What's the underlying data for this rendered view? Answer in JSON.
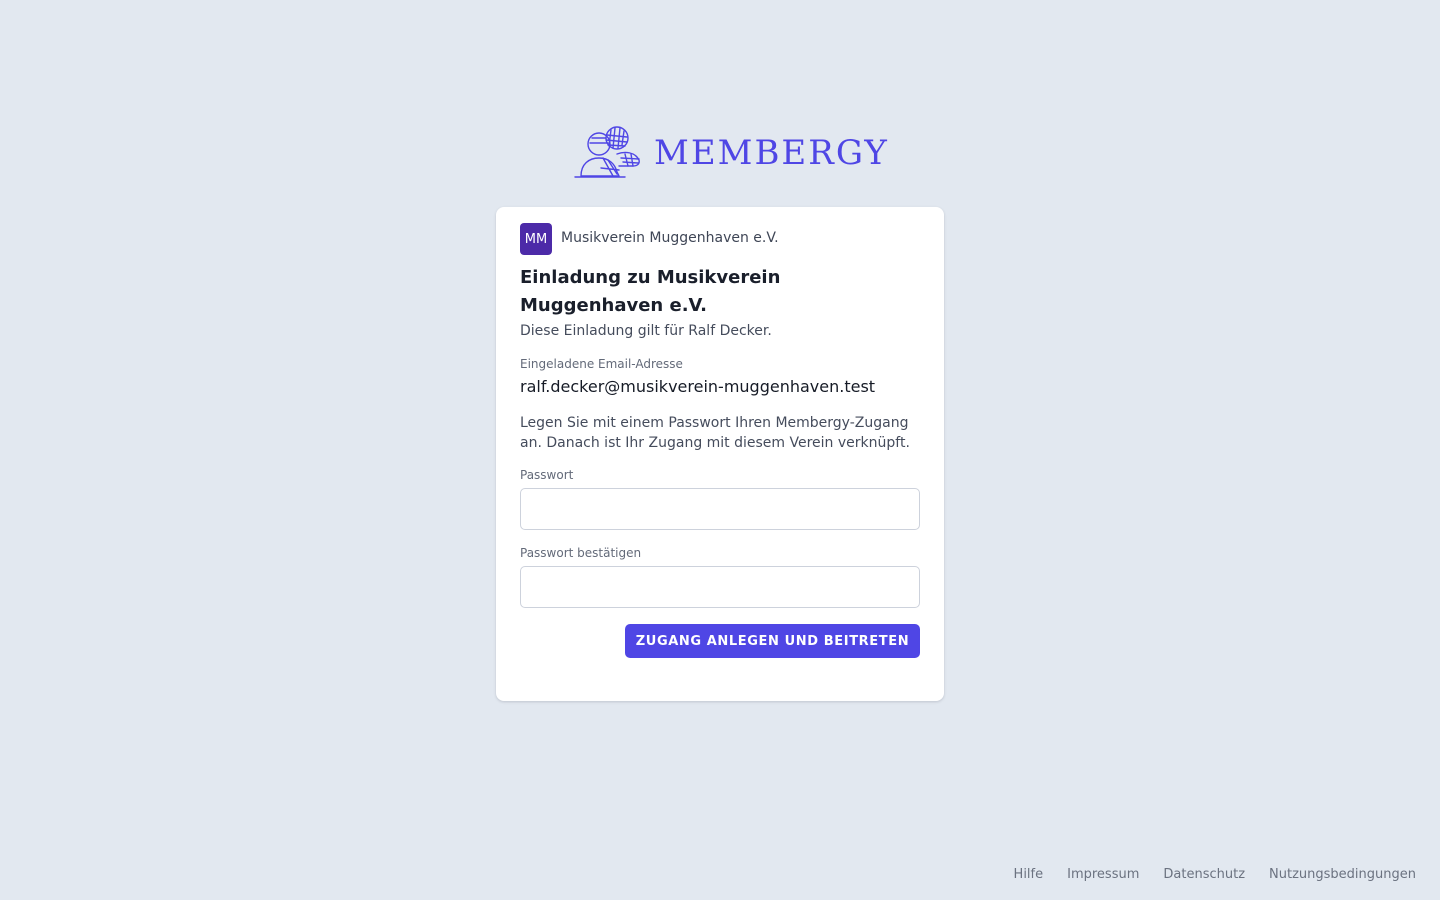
{
  "brand": {
    "name": "MEMBERGY",
    "logo_icon": "members-icon",
    "accent_color": "#4f46e5"
  },
  "organization": {
    "initials": "MM",
    "name": "Musikverein Muggenhaven e.V.",
    "avatar_color": "#4c2aa8"
  },
  "invite": {
    "title": "Einladung zu Musikverein Muggenhaven e.V.",
    "subtitle": "Diese Einladung gilt für Ralf Decker.",
    "email_label": "Eingeladene Email-Adresse",
    "email": "ralf.decker@musikverein-muggenhaven.test",
    "info": "Legen Sie mit einem Passwort Ihren Membergy-Zugang an. Danach ist Ihr Zugang mit diesem Verein verknüpft."
  },
  "form": {
    "password_label": "Passwort",
    "password_value": "",
    "password_confirm_label": "Passwort bestätigen",
    "password_confirm_value": "",
    "submit_label": "ZUGANG ANLEGEN UND BEITRETEN"
  },
  "footer": {
    "links": [
      "Hilfe",
      "Impressum",
      "Datenschutz",
      "Nutzungsbedingungen"
    ]
  }
}
